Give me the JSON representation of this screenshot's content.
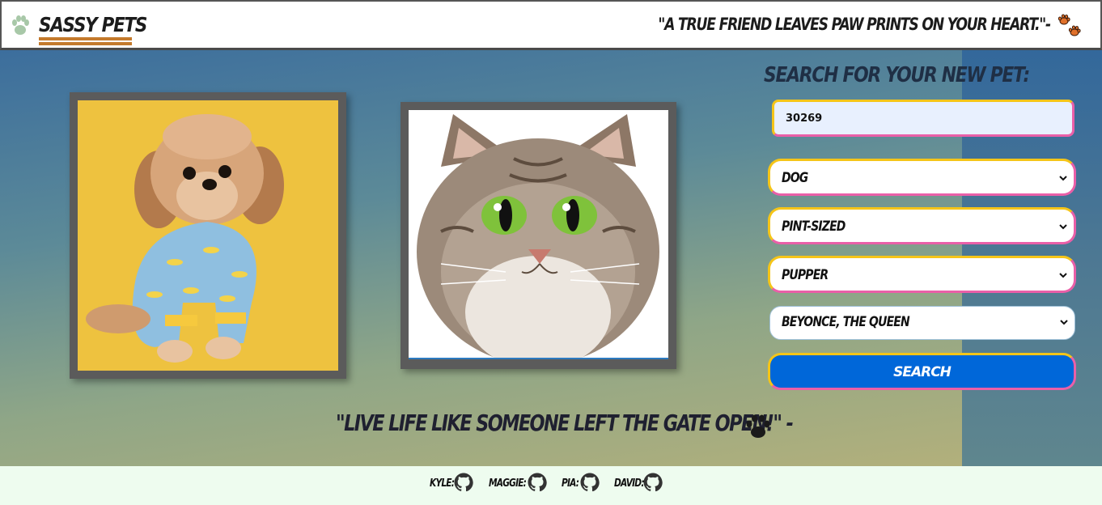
{
  "header": {
    "brand": "SASSY PETS",
    "quote": "\"A TRUE FRIEND LEAVES PAW PRINTS ON YOUR HEART.\"-",
    "logo_icon": "paw-icon",
    "quote_icon": "orange-paw-icon"
  },
  "gallery": {
    "images": [
      {
        "name": "dog-photo",
        "subject": "dog"
      },
      {
        "name": "cat-photo",
        "subject": "cat"
      }
    ]
  },
  "search": {
    "title": "SEARCH FOR YOUR NEW PET:",
    "zip_value": "30269",
    "selects": {
      "type": "DOG",
      "size": "PINT-SIZED",
      "age": "PUPPER",
      "personality": "BEYONCE, THE QUEEN"
    },
    "button_label": "SEARCH"
  },
  "main_quote": "\"LIVE LIFE LIKE SOMEONE LEFT THE GATE OPEN!\" -",
  "footer": {
    "credits": [
      {
        "label": "KYLE:",
        "icon": "github-icon"
      },
      {
        "label": "MAGGIE:",
        "icon": "github-icon"
      },
      {
        "label": "PIA:",
        "icon": "github-icon"
      },
      {
        "label": "DAVID:",
        "icon": "github-icon"
      }
    ]
  },
  "colors": {
    "accent_yellow": "#f5c518",
    "accent_pink": "#ea5fa8",
    "button_blue": "#0067d9",
    "brand_underline": "#c47a2c"
  }
}
